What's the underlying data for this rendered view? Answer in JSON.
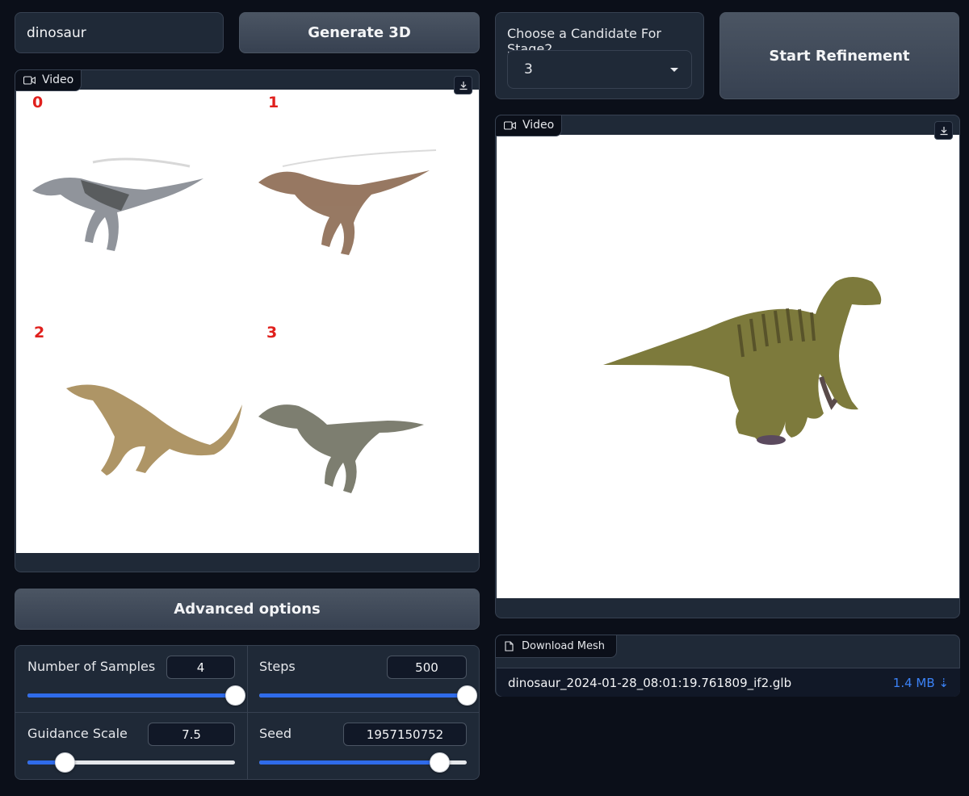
{
  "prompt_input": {
    "value": "dinosaur"
  },
  "generate_button": {
    "label": "Generate 3D"
  },
  "left_video": {
    "label": "Video",
    "candidate_numbers": [
      "0",
      "1",
      "2",
      "3"
    ]
  },
  "candidate_select": {
    "label": "Choose a Candidate For Stage2",
    "value": "3"
  },
  "refine_button": {
    "label": "Start Refinement"
  },
  "right_video": {
    "label": "Video"
  },
  "advanced_button": {
    "label": "Advanced options"
  },
  "sliders": {
    "samples": {
      "label": "Number of Samples",
      "value": "4",
      "fraction": 1.0
    },
    "steps": {
      "label": "Steps",
      "value": "500",
      "fraction": 1.0
    },
    "guidance": {
      "label": "Guidance Scale",
      "value": "7.5",
      "fraction": 0.18
    },
    "seed": {
      "label": "Seed",
      "value": "1957150752",
      "fraction": 0.87
    }
  },
  "download_mesh": {
    "label": "Download Mesh",
    "filename": "dinosaur_2024-01-28_08:01:19.761809_if2.glb",
    "size": "1.4 MB ⇣"
  },
  "colors": {
    "accent": "#2f6bea",
    "background": "#0b0f19",
    "panel": "#1f2937",
    "link": "#3b82f6"
  },
  "icons": {
    "video": "video-camera-icon",
    "download": "download-icon",
    "file": "file-icon",
    "dropdown": "caret-down-icon"
  }
}
